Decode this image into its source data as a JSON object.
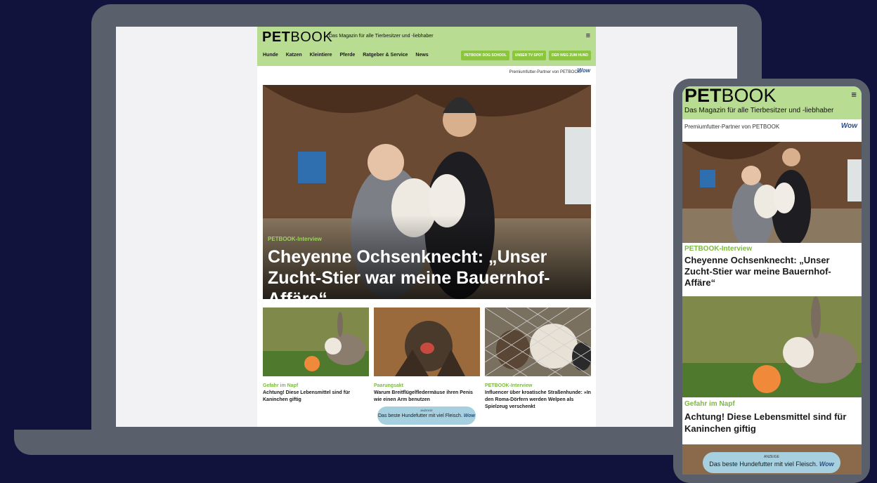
{
  "site": {
    "logo_bold": "PET",
    "logo_light": "BOOK",
    "tagline": "Das Magazin für alle Tierbesitzer und -liebhaber",
    "menu_icon": "≡",
    "nav": [
      "Hunde",
      "Katzen",
      "Kleintiere",
      "Pferde",
      "Ratgeber & Service",
      "News"
    ],
    "nav_buttons": [
      "PETBOOK DOG SCHOOL",
      "UNSER TV SPOT",
      "DER WEG ZUM HUND"
    ],
    "partner_text": "Premiumfutter-Partner von PETBOOK",
    "partner_logo": "Wow"
  },
  "hero": {
    "kicker": "PETBOOK-Interview",
    "headline": "Cheyenne Ochsenknecht: „Unser Zucht-Stier war meine Bauernhof-Affäre“"
  },
  "cards": [
    {
      "kicker": "Gefahr im Napf",
      "title": "Achtung! Diese Lebensmittel sind für Kaninchen giftig"
    },
    {
      "kicker": "Paarungsakt",
      "title": "Warum Breitflügelfledermäuse ihren Penis wie einen Arm benutzen"
    },
    {
      "kicker": "PETBOOK-Interview",
      "title": "Influencer über kroatische Straßenhunde: »In den Roma-Dörfern werden Welpen als Spielzeug verschenkt"
    }
  ],
  "ad": {
    "label": "ANZEIGE",
    "text": "Das beste Hundefutter mit viel Fleisch."
  },
  "phone": {
    "partner_text": "Premiumfutter-Partner von PETBOOK",
    "kicker1": "PETBOOK-Interview",
    "title1": "Cheyenne Ochsenknecht: „Unser Zucht-Stier war meine Bauernhof-Affäre“",
    "kicker2": "Gefahr im Napf",
    "title2": "Achtung! Diese Lebensmittel sind für Kaninchen giftig"
  }
}
